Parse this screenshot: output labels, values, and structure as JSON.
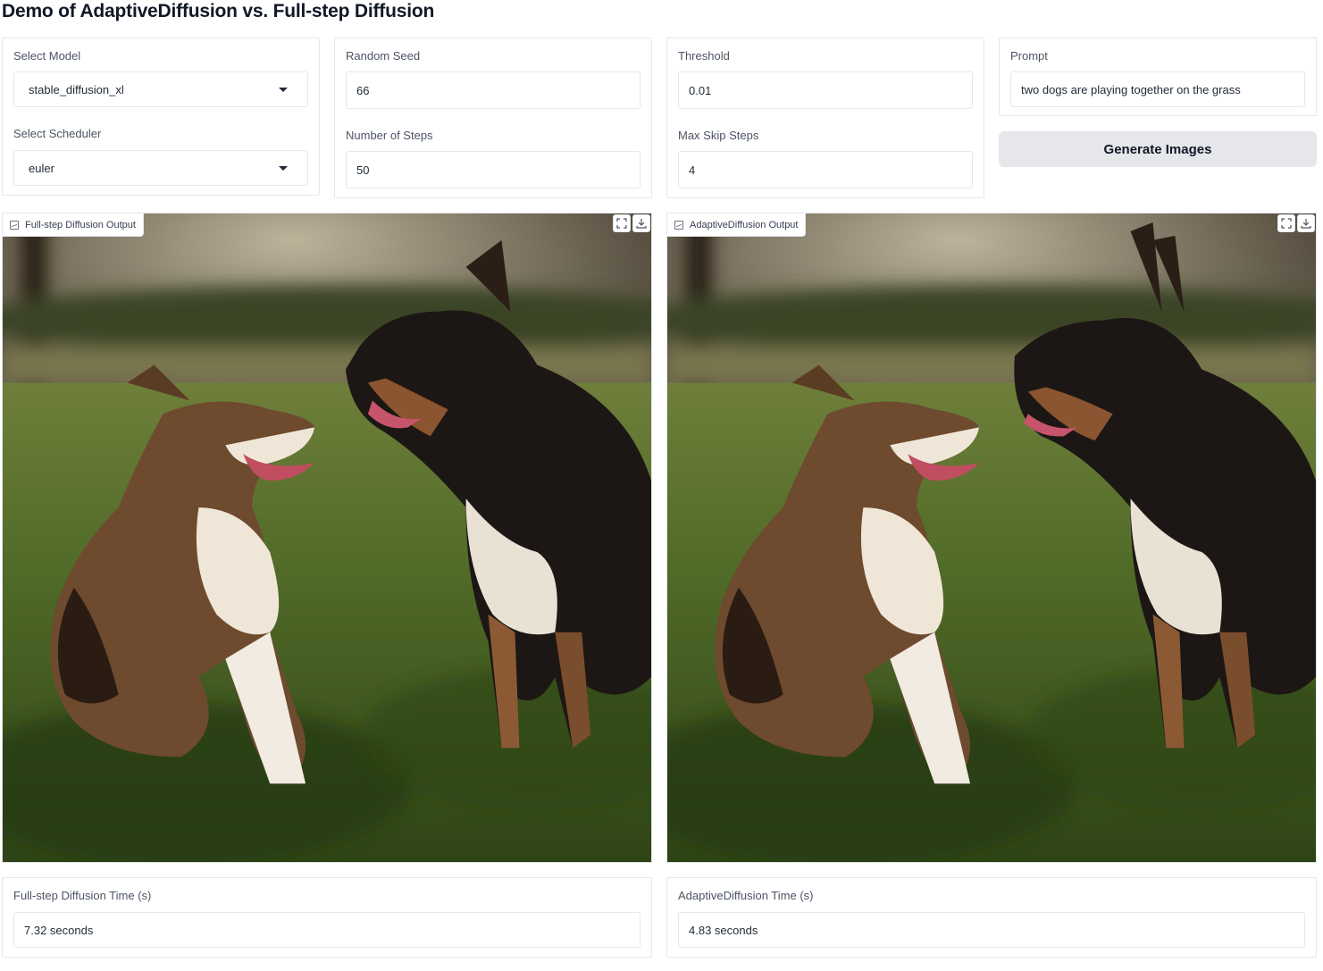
{
  "page": {
    "title": "Demo of AdaptiveDiffusion vs. Full-step Diffusion"
  },
  "controls": {
    "model": {
      "label": "Select Model",
      "value": "stable_diffusion_xl"
    },
    "scheduler": {
      "label": "Select Scheduler",
      "value": "euler"
    },
    "seed": {
      "label": "Random Seed",
      "value": "66"
    },
    "steps": {
      "label": "Number of Steps",
      "value": "50"
    },
    "threshold": {
      "label": "Threshold",
      "value": "0.01"
    },
    "max_skip": {
      "label": "Max Skip Steps",
      "value": "4"
    },
    "prompt": {
      "label": "Prompt",
      "value": "two dogs are playing together on the grass"
    },
    "generate_label": "Generate Images"
  },
  "outputs": {
    "full": {
      "label": "Full-step Diffusion Output",
      "time_label": "Full-step Diffusion Time (s)",
      "time_value": "7.32 seconds"
    },
    "adaptive": {
      "label": "AdaptiveDiffusion Output",
      "time_label": "AdaptiveDiffusion Time (s)",
      "time_value": "4.83 seconds"
    }
  },
  "icons": {
    "image": "image-icon",
    "fullscreen": "fullscreen-icon",
    "download": "download-icon",
    "dropdown": "chevron-down-icon"
  },
  "colors": {
    "button_bg": "#e5e7eb",
    "border": "#e5e7eb"
  }
}
